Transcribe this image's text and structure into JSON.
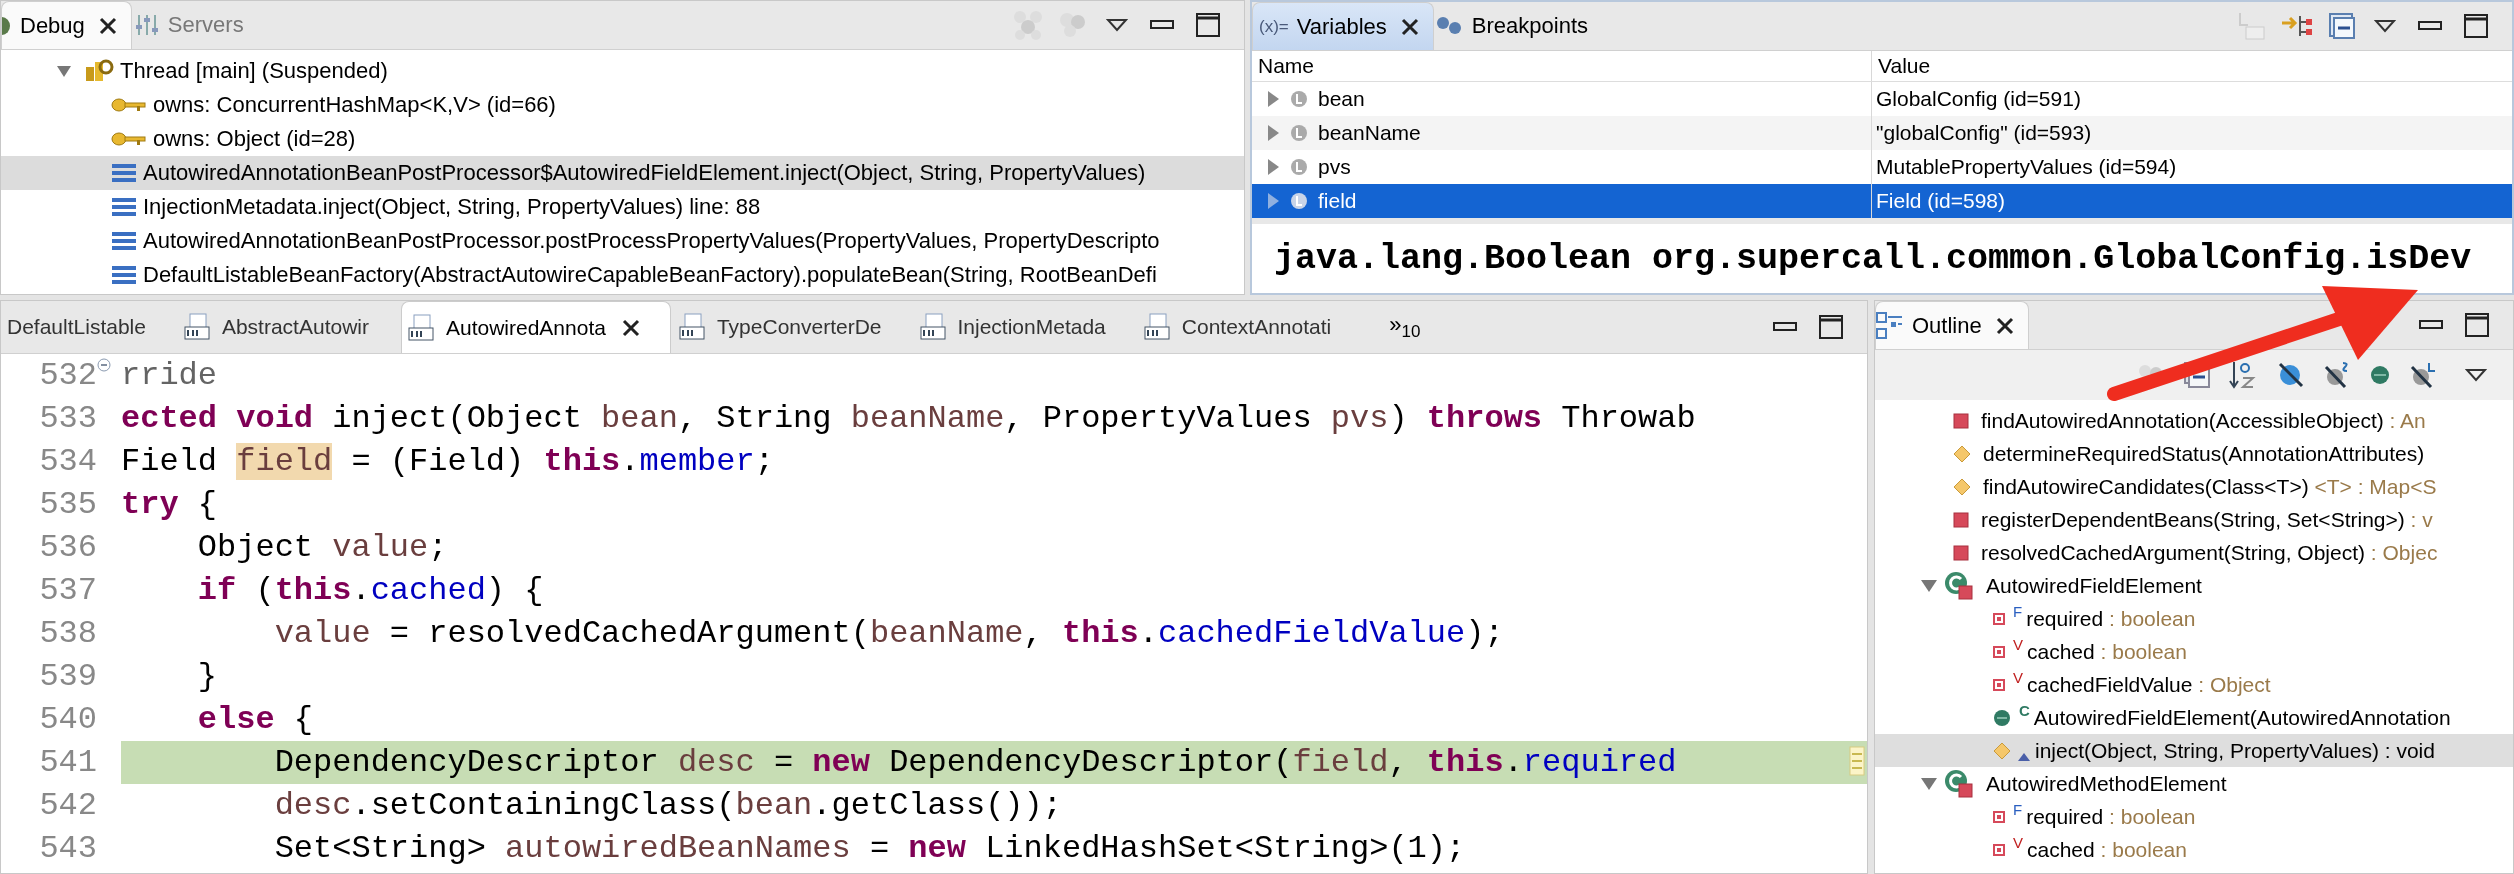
{
  "debug_view": {
    "tabs": [
      {
        "label": "Debug",
        "selected": true,
        "closable": true
      },
      {
        "label": "Servers",
        "selected": false,
        "closable": false
      }
    ],
    "tree": [
      {
        "kind": "thread",
        "label": "Thread [main] (Suspended)",
        "expanded": true,
        "selected": false,
        "children": [
          {
            "kind": "monitor",
            "label": "owns: ConcurrentHashMap<K,V>  (id=66)",
            "selected": false
          },
          {
            "kind": "monitor",
            "label": "owns: Object  (id=28)",
            "selected": false
          },
          {
            "kind": "frame",
            "label": "AutowiredAnnotationBeanPostProcessor$AutowiredFieldElement.inject(Object, String, PropertyValues)",
            "selected": true
          },
          {
            "kind": "frame",
            "label": "InjectionMetadata.inject(Object, String, PropertyValues) line: 88",
            "selected": false
          },
          {
            "kind": "frame",
            "label": "AutowiredAnnotationBeanPostProcessor.postProcessPropertyValues(PropertyValues, PropertyDescripto",
            "selected": false
          },
          {
            "kind": "frame",
            "label": "DefaultListableBeanFactory(AbstractAutowireCapableBeanFactory).populateBean(String, RootBeanDefi",
            "selected": false
          }
        ]
      }
    ]
  },
  "variables_view": {
    "tabs": [
      {
        "label": "Variables",
        "icon_text": "(x)=",
        "selected": true,
        "closable": true
      },
      {
        "label": "Breakpoints",
        "selected": false,
        "closable": false
      }
    ],
    "columns": [
      "Name",
      "Value"
    ],
    "rows": [
      {
        "name": "bean",
        "value": "GlobalConfig  (id=591)",
        "selected": false
      },
      {
        "name": "beanName",
        "value": "\"globalConfig\" (id=593)",
        "selected": false
      },
      {
        "name": "pvs",
        "value": "MutablePropertyValues  (id=594)",
        "selected": false
      },
      {
        "name": "field",
        "value": "Field  (id=598)",
        "selected": true
      }
    ],
    "detail": "java.lang.Boolean org.supercall.common.GlobalConfig.isDev"
  },
  "editor": {
    "tabs": [
      {
        "label": "DefaultListable",
        "selected": false
      },
      {
        "label": "AbstractAutowir",
        "selected": false
      },
      {
        "label": "AutowiredAnnota",
        "selected": true
      },
      {
        "label": "TypeConverterDe",
        "selected": false
      },
      {
        "label": "InjectionMetada",
        "selected": false
      },
      {
        "label": "ContextAnnotati",
        "selected": false
      }
    ],
    "overflow": "»",
    "overflow_count": "10",
    "lines": [
      {
        "number": "532",
        "current": false,
        "fold_marker": true,
        "tokens": [
          {
            "kind": "annotation",
            "text": "rride"
          }
        ]
      },
      {
        "number": "533",
        "current": false,
        "tokens": [
          {
            "kind": "keyword",
            "text": "ected void"
          },
          {
            "kind": "plain",
            "text": " inject(Object "
          },
          {
            "kind": "local",
            "text": "bean"
          },
          {
            "kind": "plain",
            "text": ", String "
          },
          {
            "kind": "local",
            "text": "beanName"
          },
          {
            "kind": "plain",
            "text": ", PropertyValues "
          },
          {
            "kind": "local",
            "text": "pvs"
          },
          {
            "kind": "plain",
            "text": ") "
          },
          {
            "kind": "keyword",
            "text": "throws"
          },
          {
            "kind": "plain",
            "text": " Throwab"
          }
        ]
      },
      {
        "number": "534",
        "current": false,
        "tokens": [
          {
            "kind": "plain",
            "text": "Field "
          },
          {
            "kind": "occurrence",
            "text": "field"
          },
          {
            "kind": "plain",
            "text": " = (Field) "
          },
          {
            "kind": "keyword",
            "text": "this"
          },
          {
            "kind": "plain",
            "text": "."
          },
          {
            "kind": "field",
            "text": "member"
          },
          {
            "kind": "plain",
            "text": ";"
          }
        ]
      },
      {
        "number": "535",
        "current": false,
        "tokens": [
          {
            "kind": "keyword",
            "text": "try"
          },
          {
            "kind": "plain",
            "text": " {"
          }
        ]
      },
      {
        "number": "536",
        "current": false,
        "tokens": [
          {
            "kind": "plain",
            "text": "    Object "
          },
          {
            "kind": "local",
            "text": "value"
          },
          {
            "kind": "plain",
            "text": ";"
          }
        ]
      },
      {
        "number": "537",
        "current": false,
        "tokens": [
          {
            "kind": "keyword",
            "text": "    if"
          },
          {
            "kind": "plain",
            "text": " ("
          },
          {
            "kind": "keyword",
            "text": "this"
          },
          {
            "kind": "plain",
            "text": "."
          },
          {
            "kind": "field",
            "text": "cached"
          },
          {
            "kind": "plain",
            "text": ") {"
          }
        ]
      },
      {
        "number": "538",
        "current": false,
        "tokens": [
          {
            "kind": "local",
            "text": "        value"
          },
          {
            "kind": "plain",
            "text": " = resolvedCachedArgument("
          },
          {
            "kind": "local",
            "text": "beanName"
          },
          {
            "kind": "plain",
            "text": ", "
          },
          {
            "kind": "keyword",
            "text": "this"
          },
          {
            "kind": "plain",
            "text": "."
          },
          {
            "kind": "field",
            "text": "cachedFieldValue"
          },
          {
            "kind": "plain",
            "text": ");"
          }
        ]
      },
      {
        "number": "539",
        "current": false,
        "tokens": [
          {
            "kind": "plain",
            "text": "    }"
          }
        ]
      },
      {
        "number": "540",
        "current": false,
        "tokens": [
          {
            "kind": "keyword",
            "text": "    else"
          },
          {
            "kind": "plain",
            "text": " {"
          }
        ]
      },
      {
        "number": "541",
        "current": true,
        "tokens": [
          {
            "kind": "plain",
            "text": "        DependencyDescriptor "
          },
          {
            "kind": "local",
            "text": "desc"
          },
          {
            "kind": "plain",
            "text": " = "
          },
          {
            "kind": "keyword",
            "text": "new"
          },
          {
            "kind": "plain",
            "text": " DependencyDescriptor("
          },
          {
            "kind": "local",
            "text": "field"
          },
          {
            "kind": "plain",
            "text": ", "
          },
          {
            "kind": "keyword",
            "text": "this"
          },
          {
            "kind": "plain",
            "text": "."
          },
          {
            "kind": "field",
            "text": "required"
          }
        ]
      },
      {
        "number": "542",
        "current": false,
        "tokens": [
          {
            "kind": "local",
            "text": "        desc"
          },
          {
            "kind": "plain",
            "text": ".setContainingClass("
          },
          {
            "kind": "local",
            "text": "bean"
          },
          {
            "kind": "plain",
            "text": ".getClass());"
          }
        ]
      },
      {
        "number": "543",
        "current": false,
        "tokens": [
          {
            "kind": "plain",
            "text": "        Set<String> "
          },
          {
            "kind": "local",
            "text": "autowiredBeanNames"
          },
          {
            "kind": "plain",
            "text": " = "
          },
          {
            "kind": "keyword",
            "text": "new"
          },
          {
            "kind": "plain",
            "text": " LinkedHashSet<String>(1);"
          }
        ]
      }
    ]
  },
  "outline_view": {
    "tab": {
      "label": "Outline",
      "selected": true
    },
    "items": [
      {
        "kind": "private-method",
        "label": "findAutowiredAnnotation(AccessibleObject)",
        "type": " : An",
        "selected": false
      },
      {
        "kind": "package-method",
        "label": "determineRequiredStatus(AnnotationAttributes)",
        "selected": false
      },
      {
        "kind": "package-method",
        "label": "findAutowireCandidates(Class<T>)",
        "type": " <T> : Map<S",
        "selected": false
      },
      {
        "kind": "private-method",
        "label": "registerDependentBeans(String, Set<String>)",
        "type": " : v",
        "selected": false
      },
      {
        "kind": "private-method",
        "label": "resolvedCachedArgument(String, Object)",
        "type": " : Objec",
        "selected": false
      },
      {
        "kind": "class",
        "label": "AutowiredFieldElement",
        "expanded": true,
        "selected": false,
        "children": [
          {
            "kind": "private-field",
            "decoration": "F",
            "label": "required",
            "type": " : boolean",
            "selected": false
          },
          {
            "kind": "private-field",
            "decoration": "V",
            "label": "cached",
            "type": " : boolean",
            "selected": false
          },
          {
            "kind": "private-field",
            "decoration": "V",
            "label": "cachedFieldValue",
            "type": " : Object",
            "selected": false
          },
          {
            "kind": "constructor",
            "decoration": "C",
            "label": "AutowiredFieldElement(AutowiredAnnotation",
            "selected": false
          },
          {
            "kind": "package-method",
            "override": true,
            "label": "inject(Object, String, PropertyValues)",
            "type": " : void",
            "selected": true
          }
        ]
      },
      {
        "kind": "class",
        "label": "AutowiredMethodElement",
        "expanded": true,
        "selected": false,
        "children": [
          {
            "kind": "private-field",
            "decoration": "F",
            "label": "required",
            "type": " : boolean",
            "selected": false
          },
          {
            "kind": "private-field",
            "decoration": "V",
            "label": "cached",
            "type": " : boolean",
            "selected": false
          }
        ]
      }
    ]
  }
}
